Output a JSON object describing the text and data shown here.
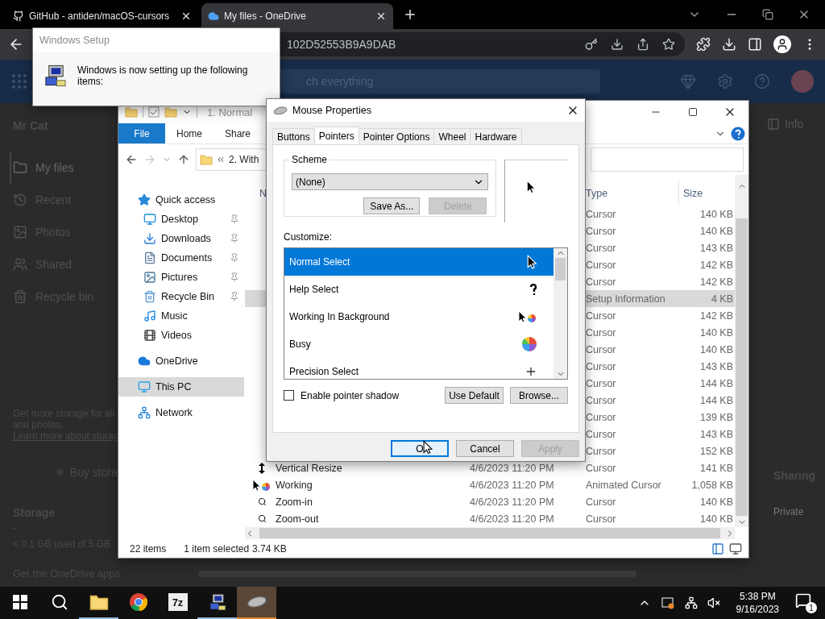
{
  "browser": {
    "tabs": [
      {
        "title": "GitHub - antiden/macOS-cursors",
        "selected": false
      },
      {
        "title": "My files - OneDrive",
        "selected": true
      }
    ],
    "address": "102D52553B9A9DAB"
  },
  "onedrive": {
    "search": {
      "placeholder": "ch everything"
    },
    "user": "Mr Cat",
    "nav": [
      {
        "label": "My files",
        "selected": true
      },
      {
        "label": "Recent",
        "selected": false
      },
      {
        "label": "Photos",
        "selected": false
      },
      {
        "label": "Shared",
        "selected": false
      },
      {
        "label": "Recycle bin",
        "selected": false
      }
    ],
    "storage_note": [
      "Get more storage for all",
      "and photos."
    ],
    "learn_more": "Learn more about storag",
    "buy_button": "Buy stora",
    "storage_title": "Storage",
    "storage_dash": "-",
    "storage_usage": "< 0.1 GB used of 5 GB",
    "apps_link": "Get the OneDrive apps",
    "info": "Info",
    "sharing": "Sharing",
    "privacy": "Private"
  },
  "setup_dialog": {
    "title": "Windows Setup",
    "message": "Windows is now setting up the following items:"
  },
  "explorer": {
    "title": "1. Normal",
    "ribbon_tabs": [
      {
        "label": "File",
        "selected": true
      },
      {
        "label": "Home",
        "selected": false
      },
      {
        "label": "Share",
        "selected": false
      }
    ],
    "path": "2. With",
    "nav": [
      {
        "label": "Quick access",
        "selected": false,
        "children": [
          {
            "label": "Desktop",
            "pinned": true,
            "selected": false
          },
          {
            "label": "Downloads",
            "pinned": true,
            "selected": false
          },
          {
            "label": "Documents",
            "pinned": true,
            "selected": false
          },
          {
            "label": "Pictures",
            "pinned": true,
            "selected": false
          },
          {
            "label": "Recycle Bin",
            "pinned": true,
            "selected": false
          },
          {
            "label": "Music",
            "pinned": false,
            "selected": false
          },
          {
            "label": "Videos",
            "pinned": false,
            "selected": false
          }
        ]
      },
      {
        "label": "OneDrive",
        "selected": false
      },
      {
        "label": "This PC",
        "selected": true
      },
      {
        "label": "Network",
        "selected": false
      }
    ],
    "columns": [
      "N",
      "Type",
      "Size"
    ],
    "rows": [
      {
        "type": "Cursor",
        "size": "140 KB",
        "selected": false
      },
      {
        "type": "Cursor",
        "size": "140 KB",
        "selected": false
      },
      {
        "type": "Cursor",
        "size": "143 KB",
        "selected": false
      },
      {
        "type": "Cursor",
        "size": "142 KB",
        "selected": false
      },
      {
        "type": "Cursor",
        "size": "142 KB",
        "selected": false
      },
      {
        "type": "Setup Information",
        "size": "4 KB",
        "selected": true
      },
      {
        "type": "Cursor",
        "size": "142 KB",
        "selected": false
      },
      {
        "type": "Cursor",
        "size": "140 KB",
        "selected": false
      },
      {
        "type": "Cursor",
        "size": "140 KB",
        "selected": false
      },
      {
        "type": "Cursor",
        "size": "143 KB",
        "selected": false
      },
      {
        "type": "Cursor",
        "size": "144 KB",
        "selected": false
      },
      {
        "type": "Cursor",
        "size": "144 KB",
        "selected": false
      },
      {
        "type": "Cursor",
        "size": "139 KB",
        "selected": false
      },
      {
        "type": "Cursor",
        "size": "143 KB",
        "selected": false
      },
      {
        "type": "Cursor",
        "size": "152 KB",
        "selected": false
      },
      {
        "name": "Vertical Resize",
        "date": "4/6/2023 11:20 PM",
        "type": "Cursor",
        "size": "141 KB",
        "selected": false
      },
      {
        "name": "Working",
        "date": "4/6/2023 11:20 PM",
        "type": "Animated Cursor",
        "size": "1,058 KB",
        "selected": false
      },
      {
        "name": "Zoom-in",
        "date": "4/6/2023 11:20 PM",
        "type": "Cursor",
        "size": "140 KB",
        "selected": false
      },
      {
        "name": "Zoom-out",
        "date": "4/6/2023 11:20 PM",
        "type": "Cursor",
        "size": "140 KB",
        "selected": false
      }
    ],
    "status": {
      "count": "22 items",
      "selection": "1 item selected",
      "size": "3.74 KB"
    }
  },
  "mouse_dialog": {
    "title": "Mouse Properties",
    "tabs": [
      {
        "label": "Buttons",
        "selected": false
      },
      {
        "label": "Pointers",
        "selected": true
      },
      {
        "label": "Pointer Options",
        "selected": false
      },
      {
        "label": "Wheel",
        "selected": false
      },
      {
        "label": "Hardware",
        "selected": false
      }
    ],
    "scheme_label": "Scheme",
    "scheme_value": "(None)",
    "scheme_buttons": [
      {
        "label": "Save As...",
        "disabled": false
      },
      {
        "label": "Delete",
        "disabled": true
      }
    ],
    "customize_label": "Customize:",
    "pointers": [
      {
        "label": "Normal Select",
        "selected": true
      },
      {
        "label": "Help Select",
        "selected": false
      },
      {
        "label": "Working In Background",
        "selected": false
      },
      {
        "label": "Busy",
        "selected": false
      },
      {
        "label": "Precision Select",
        "selected": false
      }
    ],
    "shadow": {
      "label": "Enable pointer shadow",
      "checked": false
    },
    "list_buttons": [
      "Use Default",
      "Browse..."
    ],
    "buttons": [
      {
        "label": "O",
        "disabled": false,
        "focused": true
      },
      {
        "label": "Cancel",
        "disabled": false,
        "focused": false
      },
      {
        "label": "Apply",
        "disabled": true,
        "focused": false
      }
    ]
  },
  "taskbar": {
    "apps": [
      {
        "running": false,
        "active": false
      },
      {
        "running": true,
        "active": false
      },
      {
        "running": false,
        "active": false
      },
      {
        "label": "7z",
        "running": false,
        "active": false
      },
      {
        "running": true,
        "active": false
      },
      {
        "running": true,
        "active": true
      }
    ],
    "time": "5:38 PM",
    "date": "9/16/2023",
    "notifications": "1"
  }
}
